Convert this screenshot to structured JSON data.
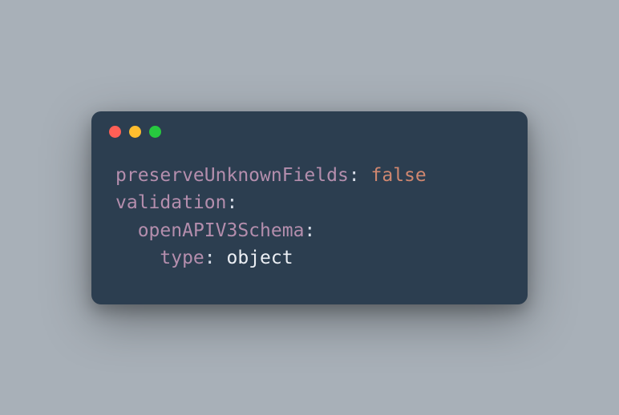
{
  "window": {
    "traffic_lights": [
      "red",
      "yellow",
      "green"
    ]
  },
  "code": {
    "line1": {
      "key": "preserveUnknownFields",
      "colon": ":",
      "space": " ",
      "value": "false"
    },
    "line2": {
      "key": "validation",
      "colon": ":"
    },
    "line3": {
      "indent": "  ",
      "key": "openAPIV3Schema",
      "colon": ":"
    },
    "line4": {
      "indent": "    ",
      "key": "type",
      "colon": ":",
      "space": " ",
      "value": "object"
    }
  }
}
